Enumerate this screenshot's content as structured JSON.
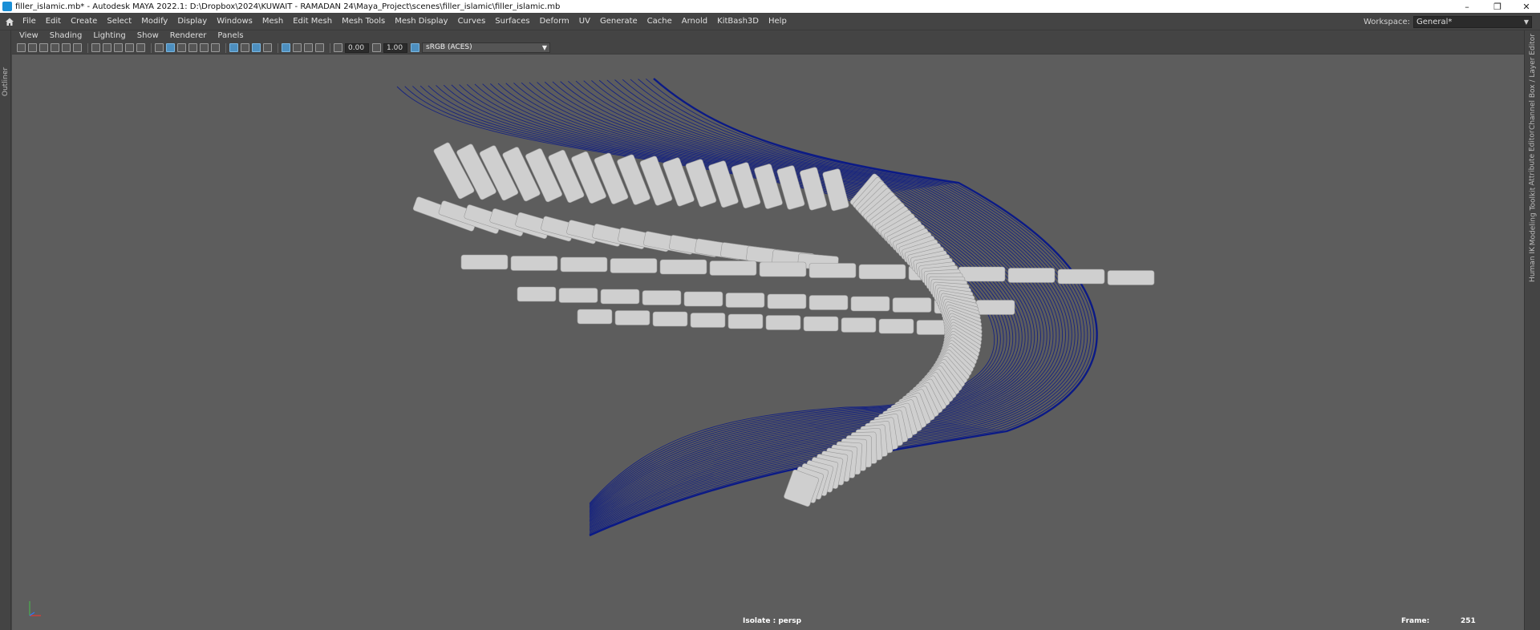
{
  "window": {
    "title": "filler_islamic.mb* - Autodesk MAYA 2022.1: D:\\Dropbox\\2024\\KUWAIT - RAMADAN 24\\Maya_Project\\scenes\\filler_islamic\\filler_islamic.mb",
    "minimize_glyph": "–",
    "restore_glyph": "❐",
    "close_glyph": "✕"
  },
  "menubar": {
    "items": [
      "File",
      "Edit",
      "Create",
      "Select",
      "Modify",
      "Display",
      "Windows",
      "Mesh",
      "Edit Mesh",
      "Mesh Tools",
      "Mesh Display",
      "Curves",
      "Surfaces",
      "Deform",
      "UV",
      "Generate",
      "Cache",
      "Arnold",
      "KitBash3D",
      "Help"
    ],
    "workspace_label": "Workspace:",
    "workspace_value": "General*"
  },
  "left_strip": {
    "tab": "Outliner"
  },
  "right_strip": {
    "tabs": [
      "Channel Box / Layer Editor",
      "Attribute Editor",
      "Modeling Toolkit",
      "Human IK"
    ]
  },
  "panel_menu": {
    "items": [
      "View",
      "Shading",
      "Lighting",
      "Show",
      "Renderer",
      "Panels"
    ]
  },
  "panel_toolbar": {
    "exposure": "0.00",
    "gamma": "1.00",
    "color_space": "sRGB (ACES)"
  },
  "hud": {
    "isolate": "Isolate : persp",
    "frame_label": "Frame:",
    "frame_value": "251"
  },
  "colors": {
    "viewport_bg": "#5d5d5d",
    "curve_color": "#0b1a86",
    "mesh_color": "#cfcfcf",
    "ui_bg": "#444444"
  }
}
